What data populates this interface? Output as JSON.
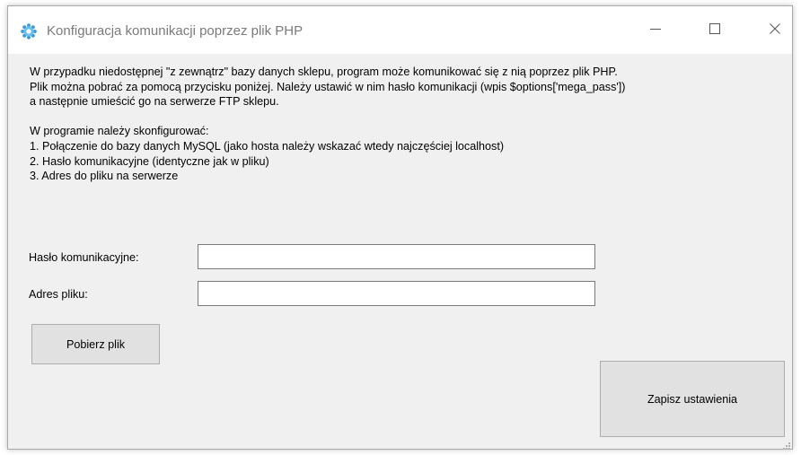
{
  "window": {
    "title": "Konfiguracja komunikacji poprzez plik PHP",
    "icon": "app-gear-icon",
    "controls": [
      "minimize-icon",
      "maximize-icon",
      "close-icon"
    ]
  },
  "description": {
    "lines": [
      "W przypadku niedostępnej \"z zewnątrz\" bazy danych sklepu, program może komunikować się z nią poprzez plik PHP.",
      "Plik można pobrać za pomocą przycisku poniżej. Należy ustawić w nim hasło komunikacji (wpis $options['mega_pass'])",
      "a następnie umieścić go na serwerze FTP sklepu."
    ],
    "config_heading": "W programie należy skonfigurować:",
    "steps": [
      "1. Połączenie do bazy danych MySQL (jako hosta należy wskazać wtedy najczęściej localhost)",
      "2. Hasło komunikacyjne (identyczne jak w pliku)",
      "3. Adres do pliku na serwerze"
    ]
  },
  "form": {
    "password_label": "Hasło komunikacyjne:",
    "password_value": "",
    "address_label": "Adres pliku:",
    "address_value": ""
  },
  "buttons": {
    "download_label": "Pobierz plik",
    "save_label": "Zapisz ustawienia"
  },
  "colors": {
    "window_bg": "#f0f0f0",
    "titlebar_bg": "#ffffff",
    "button_bg": "#e1e1e1",
    "icon_accent": "#3b9ad9"
  }
}
